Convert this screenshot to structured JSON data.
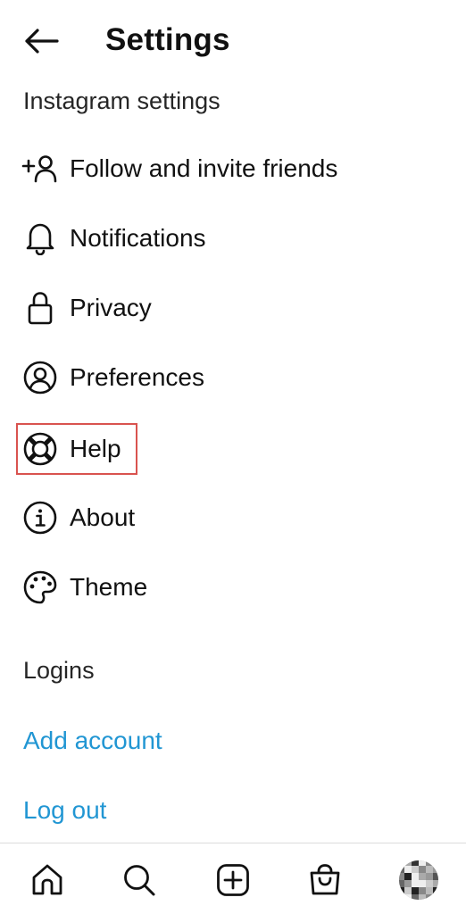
{
  "header": {
    "title": "Settings",
    "back_icon": "arrow-left-icon"
  },
  "sections": {
    "instagram_settings": "Instagram settings",
    "logins": "Logins"
  },
  "menu": {
    "items": [
      {
        "label": "Follow and invite friends",
        "icon": "add-person-icon"
      },
      {
        "label": "Notifications",
        "icon": "bell-icon"
      },
      {
        "label": "Privacy",
        "icon": "lock-icon"
      },
      {
        "label": "Preferences",
        "icon": "account-circle-icon"
      },
      {
        "label": "Help",
        "icon": "lifebuoy-icon",
        "highlighted": true
      },
      {
        "label": "About",
        "icon": "info-icon"
      },
      {
        "label": "Theme",
        "icon": "palette-icon"
      }
    ]
  },
  "logins": {
    "add_account": "Add account",
    "log_out": "Log out"
  },
  "bottom_nav": {
    "items": [
      "home-icon",
      "search-icon",
      "create-icon",
      "shop-icon",
      "profile-avatar"
    ]
  },
  "colors": {
    "link": "#2196d3",
    "highlight_border": "#d9534f",
    "text": "#111111",
    "divider": "#dbdbdb"
  }
}
